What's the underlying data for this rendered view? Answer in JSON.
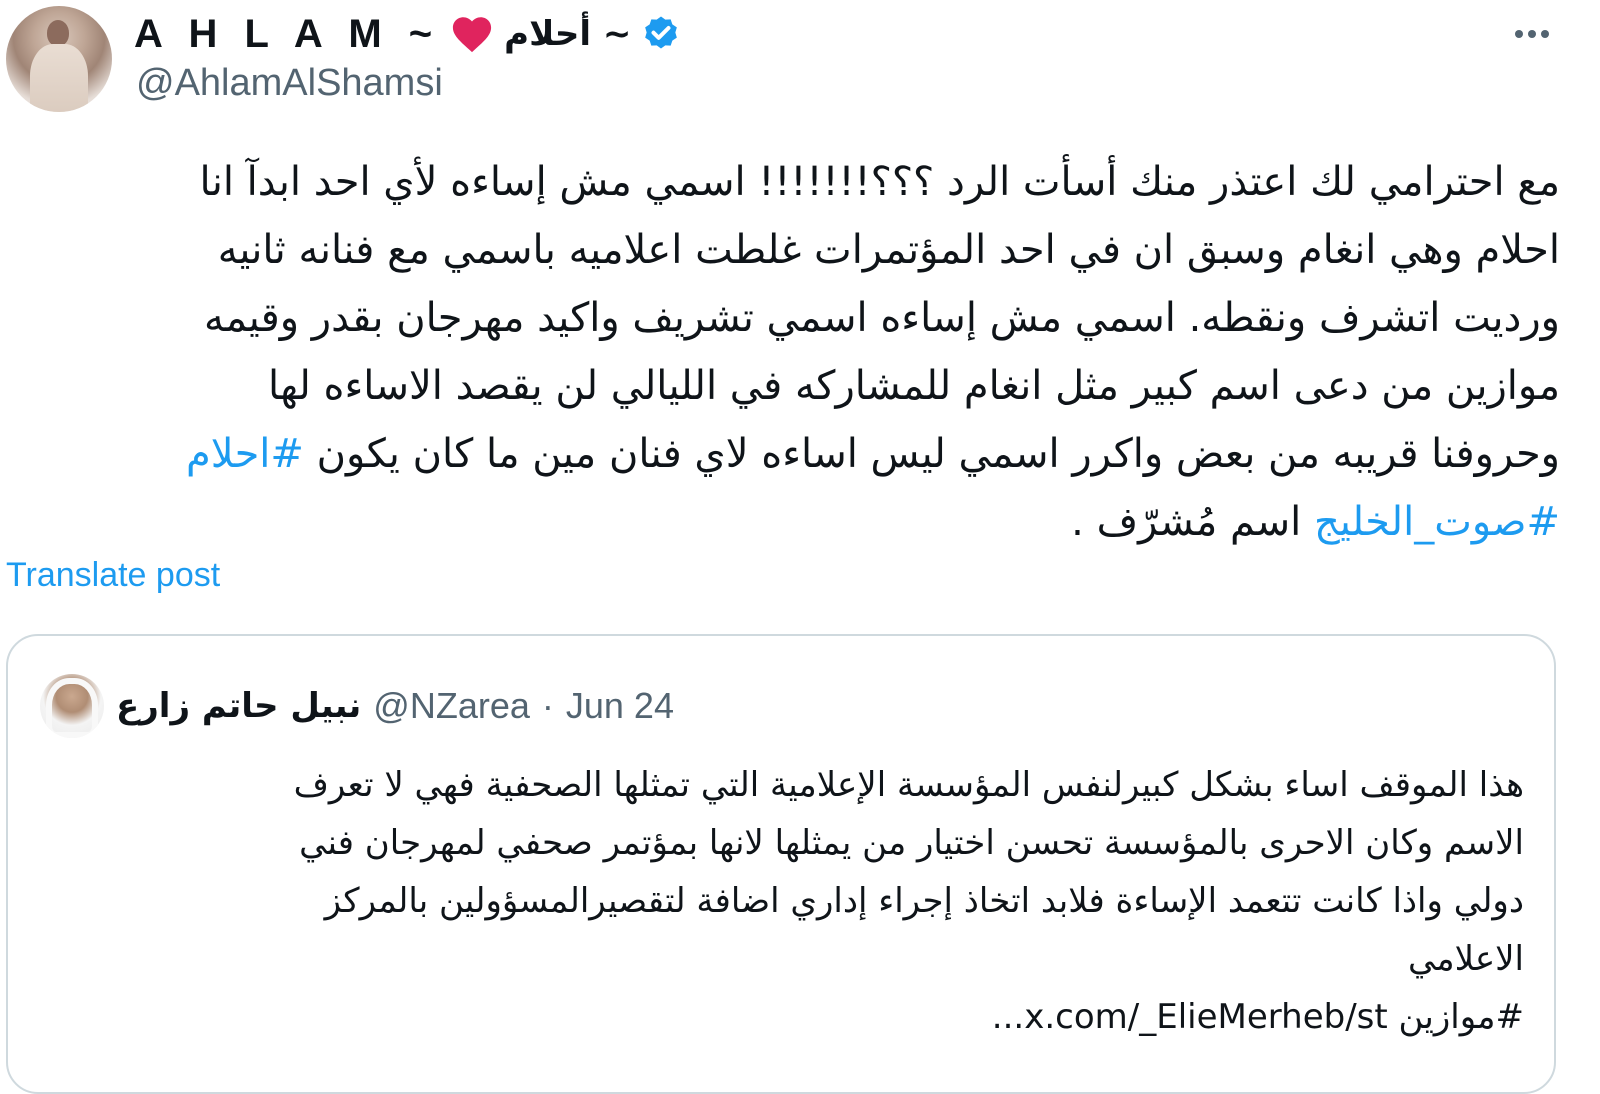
{
  "author": {
    "display_name_latin": "A H L A M ~",
    "display_name_arabic": "~ أحلام",
    "handle": "@AhlamAlShamsi",
    "avatar_icon": "profile-photo"
  },
  "post": {
    "lines": [
      "مع احترامي لك اعتذر منك أسأت الرد ؟؟؟!!!!!!! اسمي مش إساءه لأي احد  ابدآ انا",
      "احلام وهي انغام وسبق ان في احد المؤتمرات غلطت اعلاميه باسمي مع فنانه ثانيه",
      "ورديت اتشرف ونقطه. اسمي مش إساءه اسمي تشريف واكيد مهرجان بقدر وقيمه",
      "موازين من دعى اسم كبير مثل انغام للمشاركه في الليالي لن يقصد الاساءه لها"
    ],
    "line5_text": "وحروفنا قريبه من بعض  واكرر اسمي ليس اساءه لاي فنان مين ما كان يكون ",
    "line5_hashtag": "#احلام",
    "line6_hashtag": "#صوت_الخليج",
    "line6_text": " اسم مُشرّف ."
  },
  "translate_label": "Translate post",
  "quote": {
    "name": "نبيل حاتم زارع",
    "handle": "@NZarea",
    "separator": "·",
    "date": "Jun 24",
    "lines": [
      "هذا الموقف اساء بشكل كبيرلنفس المؤسسة الإعلامية التي تمثلها الصحفية فهي لا تعرف",
      "الاسم وكان الاحرى بالمؤسسة تحسن اختيار من يمثلها لانها بمؤتمر صحفي لمهرجان فني",
      "دولي واذا كانت تتعمد الإساءة فلابد اتخاذ إجراء إداري اضافة لتقصيرالمسؤولين بالمركز",
      "الاعلامي"
    ],
    "link_line": "#موازين x.com/_ElieMerheb/st..."
  },
  "colors": {
    "accent": "#1d9bf0",
    "text": "#0f1419",
    "secondary": "#536471",
    "border": "#cfd9de",
    "heart": "#e0245e"
  }
}
